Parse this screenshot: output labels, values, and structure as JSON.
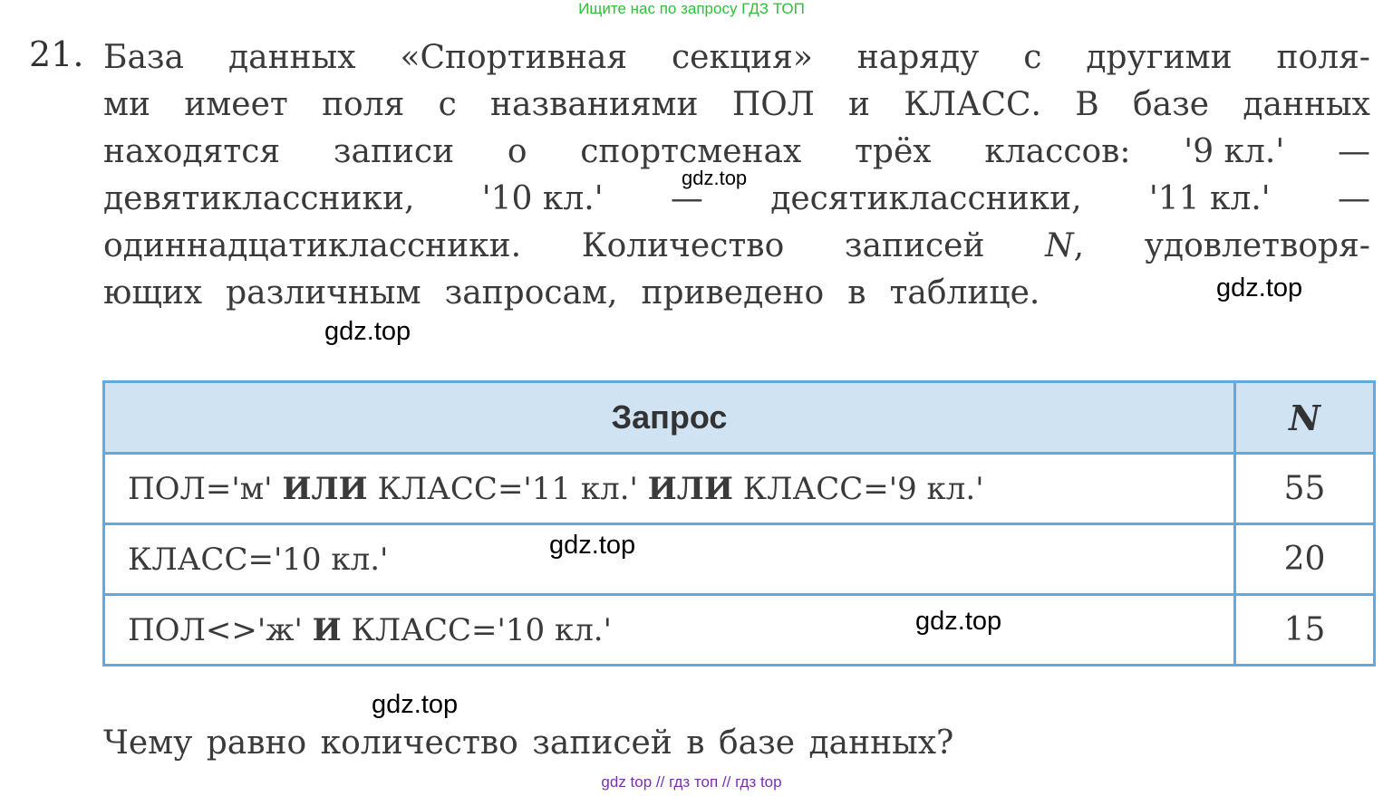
{
  "watermark_top": "Ищите нас по запросу ГДЗ ТОП",
  "problem": {
    "number": "21.",
    "lines": [
      [
        "База",
        "данных",
        "«Спортивная",
        "секция»",
        "наряду",
        "с",
        "другими",
        "поля-"
      ],
      [
        "ми",
        "имеет",
        "поля",
        "с",
        "названиями",
        "ПОЛ",
        "и",
        "КЛАСС.",
        "В",
        "базе",
        "данных"
      ],
      [
        "находятся",
        "записи",
        "о",
        "спортсменах",
        "трёх",
        "классов:",
        "'9 кл.'",
        "—"
      ],
      [
        "девятиклассники,",
        "'10 кл.'",
        "—",
        "десятиклассники,",
        "'11 кл.'",
        "—"
      ],
      [
        "одиннадцатиклассники.",
        "Количество",
        "записей",
        "N,",
        "удовлетворя-"
      ],
      [
        "ющих",
        "различным",
        "запросам,",
        "приведено",
        "в",
        "таблице."
      ]
    ]
  },
  "table": {
    "header_query": "Запрос",
    "header_n": "N",
    "rows": [
      {
        "parts": [
          {
            "t": "ПОЛ='м' ",
            "b": false
          },
          {
            "t": "ИЛИ",
            "b": true
          },
          {
            "t": " КЛАСС='11 кл.' ",
            "b": false
          },
          {
            "t": "ИЛИ",
            "b": true
          },
          {
            "t": " КЛАСС='9 кл.'",
            "b": false
          }
        ],
        "n": "55"
      },
      {
        "parts": [
          {
            "t": "КЛАСС='10 кл.'",
            "b": false
          }
        ],
        "n": "20"
      },
      {
        "parts": [
          {
            "t": "ПОЛ<>'ж' ",
            "b": false
          },
          {
            "t": "И",
            "b": true
          },
          {
            "t": " КЛАСС='10 кл.'",
            "b": false
          }
        ],
        "n": "15"
      }
    ]
  },
  "question": "Чему равно количество записей в базе данных?",
  "gdz_marks": [
    "gdz.top",
    "gdz.top",
    "gdz.top",
    "gdz.top",
    "gdz.top",
    "gdz.top"
  ],
  "watermark_bottom": "gdz top // гдз топ // гдз top"
}
